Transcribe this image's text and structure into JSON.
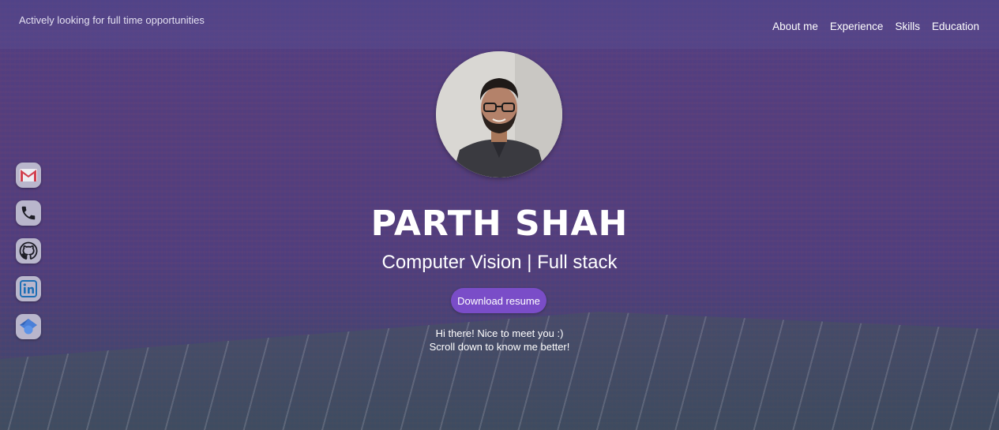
{
  "header": {
    "tagline": "Actively looking for full time opportunities",
    "nav": [
      {
        "label": "About me"
      },
      {
        "label": "Experience"
      },
      {
        "label": "Skills"
      },
      {
        "label": "Education"
      }
    ]
  },
  "social": [
    {
      "icon": "gmail-icon"
    },
    {
      "icon": "phone-icon"
    },
    {
      "icon": "github-icon"
    },
    {
      "icon": "linkedin-icon"
    },
    {
      "icon": "google-scholar-icon"
    }
  ],
  "profile": {
    "name": "PARTH SHAH",
    "subtitle": "Computer Vision | Full stack",
    "resume_button": "Download resume",
    "greeting_line1": "Hi there! Nice to meet you :)",
    "greeting_line2": "Scroll down to know me better!"
  },
  "colors": {
    "accent": "#7a4dc8",
    "overlay": "#4a3c84"
  }
}
